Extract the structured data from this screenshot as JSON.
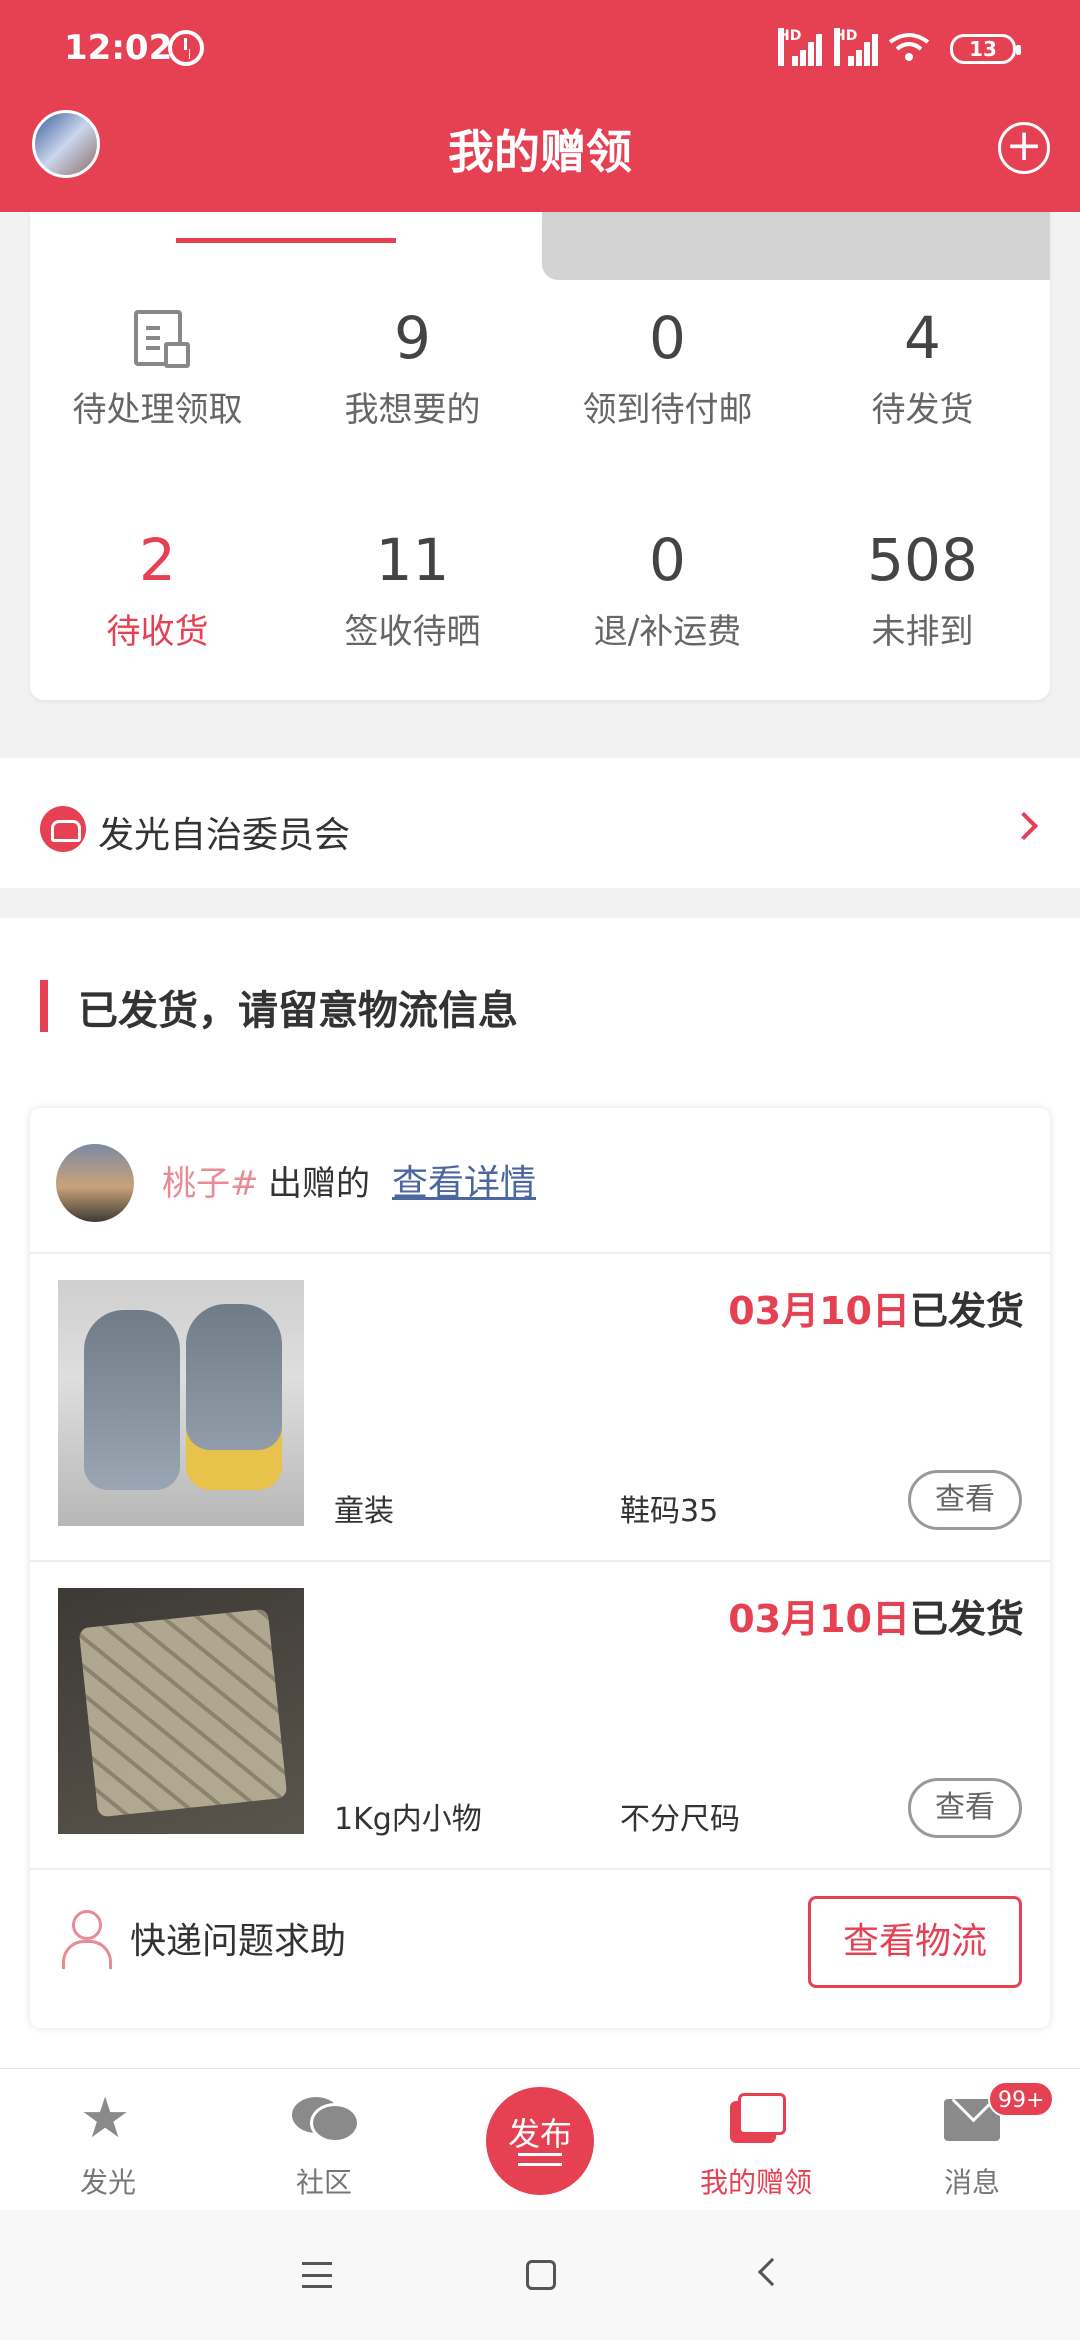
{
  "status_bar": {
    "time": "12:02",
    "battery": "13",
    "signal_labels": [
      "HD",
      "HD"
    ]
  },
  "header": {
    "title": "我的赠领",
    "add_icon": "plus-circle-icon"
  },
  "stats": {
    "row1": [
      {
        "value": "",
        "label": "待处理领取",
        "icon": "document-icon"
      },
      {
        "value": "9",
        "label": "我想要的"
      },
      {
        "value": "0",
        "label": "领到待付邮"
      },
      {
        "value": "4",
        "label": "待发货"
      }
    ],
    "row2": [
      {
        "value": "2",
        "label": "待收货",
        "active": true
      },
      {
        "value": "11",
        "label": "签收待晒"
      },
      {
        "value": "0",
        "label": "退/补运费"
      },
      {
        "value": "508",
        "label": "未排到"
      }
    ]
  },
  "committee": {
    "label": "发光自治委员会"
  },
  "shipping": {
    "title": "已发货，请留意物流信息",
    "donor": {
      "name": "桃子#",
      "suffix": "出赠的",
      "link": "查看详情"
    },
    "items": [
      {
        "date": "03月10日",
        "status": "已发货",
        "category": "童装",
        "size": "鞋码35",
        "view": "查看"
      },
      {
        "date": "03月10日",
        "status": "已发货",
        "category": "1Kg内小物",
        "size": "不分尺码",
        "view": "查看"
      }
    ],
    "help": {
      "label": "快递问题求助",
      "button": "查看物流"
    }
  },
  "bottom_nav": {
    "items": [
      {
        "label": "发光",
        "icon": "star-icon"
      },
      {
        "label": "社区",
        "icon": "chat-icon"
      },
      {
        "label": "发布",
        "icon": "publish-icon"
      },
      {
        "label": "我的赠领",
        "icon": "gift-icon",
        "active": true
      },
      {
        "label": "消息",
        "icon": "mail-icon",
        "badge": "99+"
      }
    ]
  },
  "colors": {
    "accent": "#e64053",
    "link": "#4a67a0"
  }
}
